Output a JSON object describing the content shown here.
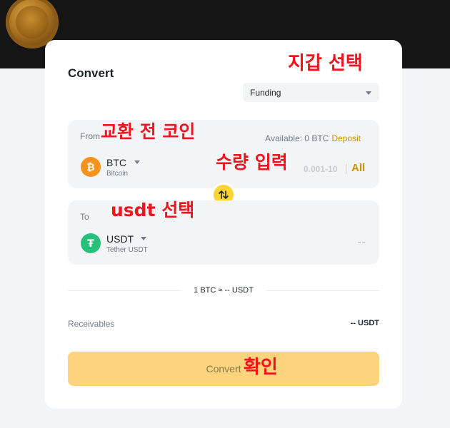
{
  "header": {
    "title": "Convert"
  },
  "annotations": {
    "wallet": "지갑 선택",
    "from_coin": "교환 전 코인",
    "amount": "수량 입력",
    "to_coin": "usdt 선택",
    "confirm": "확인"
  },
  "wallet_select": {
    "value": "Funding"
  },
  "from": {
    "label": "From",
    "available_text": "Available: 0 BTC",
    "deposit_label": "Deposit",
    "coin_symbol": "BTC",
    "coin_name": "Bitcoin",
    "amount_placeholder": "0.001-10",
    "all_label": "All"
  },
  "to": {
    "label": "To",
    "coin_symbol": "USDT",
    "coin_name": "Tether USDT",
    "amount": "--"
  },
  "rate": "1 BTC ≈ -- USDT",
  "receivables": {
    "label": "Receivables",
    "value": "-- USDT"
  },
  "convert_button": {
    "label": "Convert"
  },
  "icons": {
    "btc": "bitcoin-icon",
    "usdt": "tether-icon",
    "swap": "swap-arrows-icon",
    "dropdown": "chevron-down-icon"
  },
  "colors": {
    "accent": "#fcd535",
    "annotation": "#f0141e",
    "btc": "#f7931a",
    "usdt": "#26c17b",
    "link": "#c99400"
  }
}
